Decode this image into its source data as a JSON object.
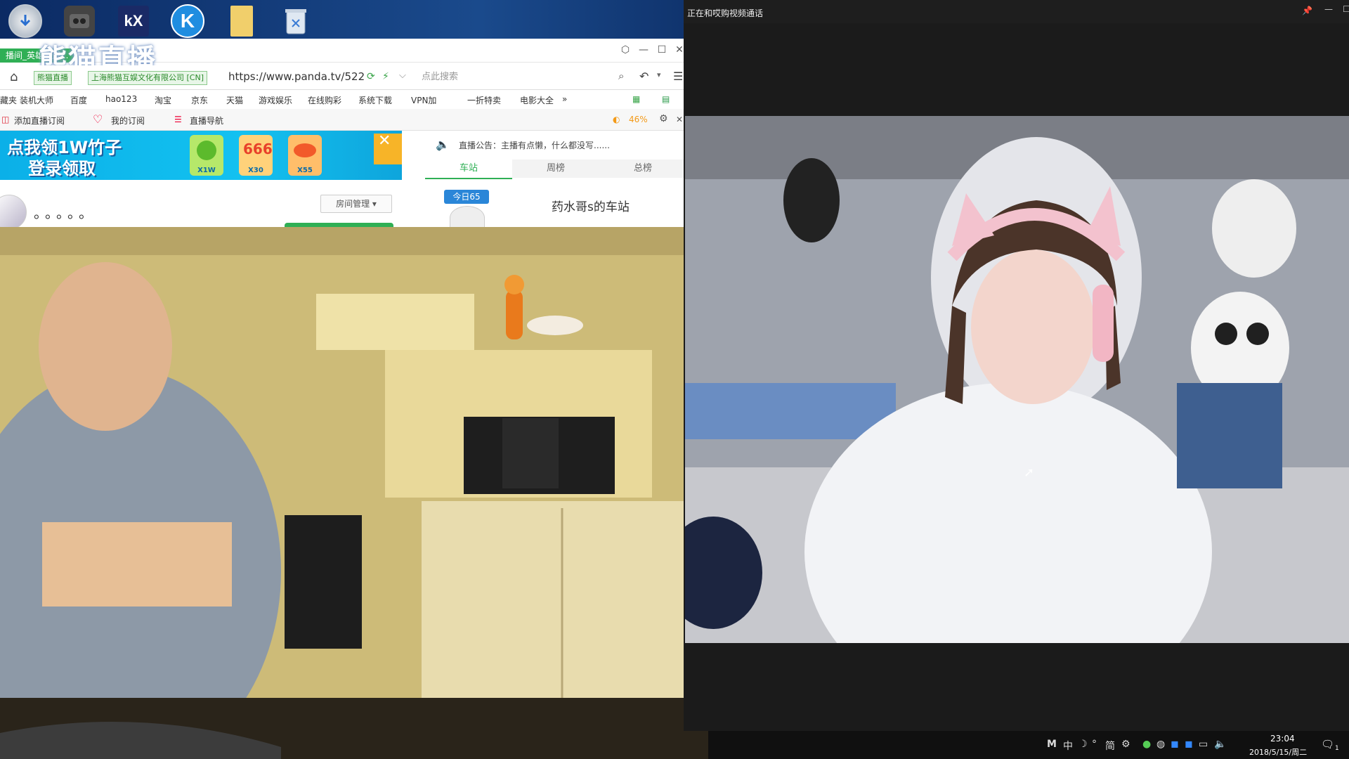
{
  "desktop": {
    "icons": [
      "installer-icon",
      "media-player-icon",
      "kx-icon",
      "kugou-icon",
      "folder-icon",
      "recycle-bin-icon"
    ]
  },
  "browser": {
    "tab_title": "播间_英雄联盟...",
    "logo_text": "熊猫直播",
    "site_tags": {
      "site_name": "熊猫直播",
      "cert": "上海熊猫互娱文化有限公司 [CN]"
    },
    "url": "https://www.panda.tv/522",
    "search_placeholder": "点此搜索",
    "bookmarks": [
      "藏夹",
      "装机大师",
      "百度",
      "hao123",
      "淘宝",
      "京东",
      "天猫",
      "游戏娱乐",
      "在线购彩",
      "系统下载",
      "VPN加",
      "一折特卖",
      "电影大全",
      "»"
    ],
    "toolbar": {
      "add_subscription": "添加直播订阅",
      "my_subscription": "我的订阅",
      "live_nav": "直播导航",
      "zoom": "46%"
    },
    "banner": {
      "line1": "点我领1W竹子",
      "line2": "登录领取",
      "gifts": [
        "X1W",
        "X30",
        "X55"
      ]
    },
    "announcement": "直播公告：主播有点懒，什么都没写......",
    "tabs": [
      "车站",
      "周榜",
      "总榜"
    ],
    "station": {
      "badge": "今日65",
      "title": "药水哥s的车站"
    },
    "room": {
      "dots": "。。。。。",
      "manage": "房间管理"
    }
  },
  "call_window": {
    "title": "正在和哎购视频通话"
  },
  "taskbar": {
    "ime": [
      "M",
      "中",
      "☽",
      "°",
      "简"
    ],
    "time": "23:04",
    "date": "2018/5/15/周二",
    "notification_count": "1"
  },
  "colors": {
    "panda_green": "#2faf55",
    "banner_blue": "#13c1f0",
    "taskbar": "#101010"
  }
}
